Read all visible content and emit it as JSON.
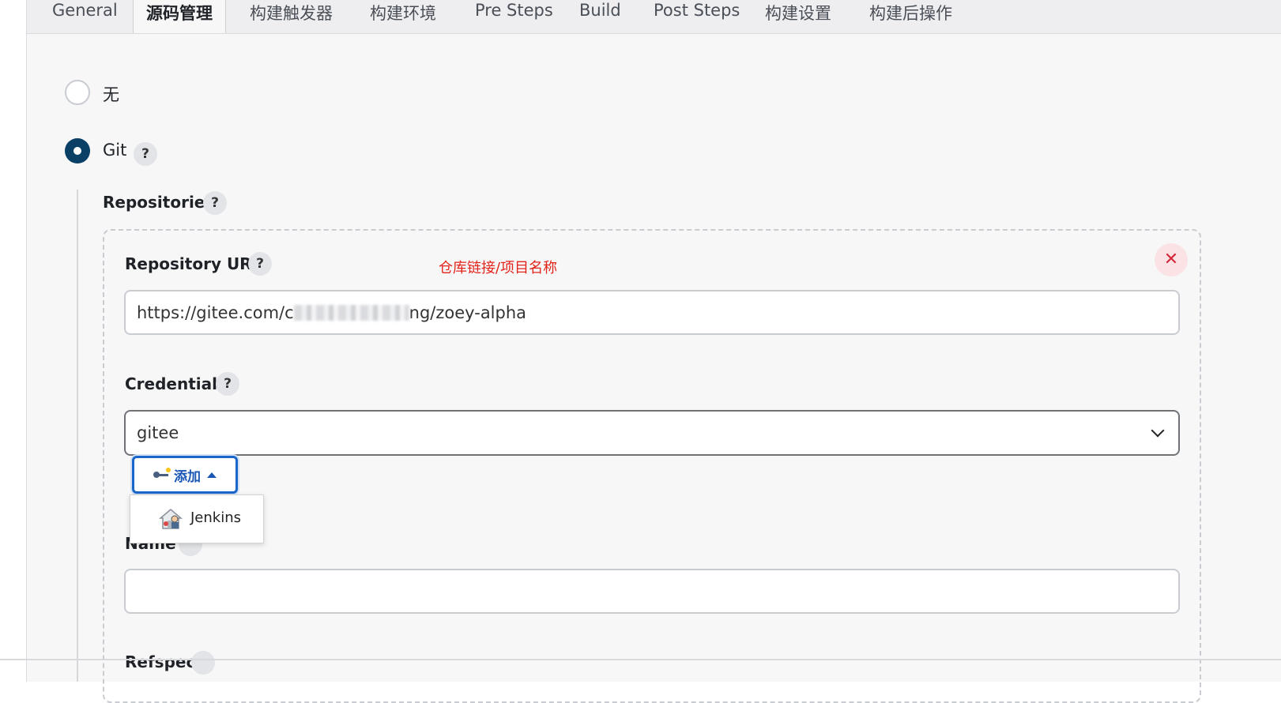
{
  "tabs": [
    {
      "label": "General",
      "active": false
    },
    {
      "label": "源码管理",
      "active": true
    },
    {
      "label": "构建触发器",
      "active": false
    },
    {
      "label": "构建环境",
      "active": false
    },
    {
      "label": "Pre Steps",
      "active": false
    },
    {
      "label": "Build",
      "active": false
    },
    {
      "label": "Post Steps",
      "active": false
    },
    {
      "label": "构建设置",
      "active": false
    },
    {
      "label": "构建后操作",
      "active": false
    }
  ],
  "scm": {
    "options": [
      {
        "label": "无",
        "selected": false
      },
      {
        "label": "Git",
        "selected": true
      }
    ],
    "help_glyph": "?",
    "repositories_label": "Repositories",
    "repository": {
      "url_label": "Repository URL",
      "annotation": "仓库链接/项目名称",
      "url_prefix": "https://gitee.com/c",
      "url_suffix": "ng/zoey-alpha",
      "credentials_label": "Credentials",
      "credentials_value": "gitee",
      "add_button_label": "添加",
      "add_menu_items": [
        {
          "label": "Jenkins",
          "icon": "jenkins-icon"
        }
      ],
      "name_label": "Name",
      "name_value": "",
      "refspec_label": "Refspec",
      "delete_icon": "close-icon"
    }
  },
  "colors": {
    "radio_selected": "#0a3f66",
    "annotation": "#e2231a",
    "add_button": "#1a56b5",
    "close": "#d6283b"
  }
}
